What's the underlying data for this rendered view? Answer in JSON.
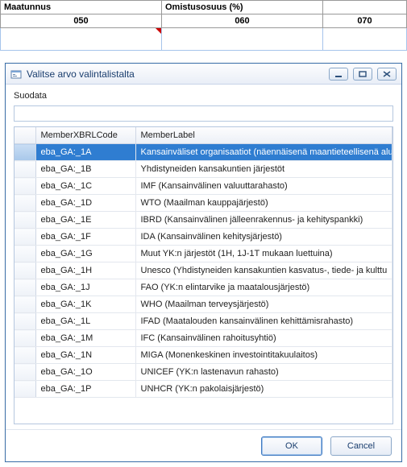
{
  "bgTable": {
    "headers": [
      "Maatunnus",
      "Omistusosuus (%)",
      ""
    ],
    "codes": [
      "050",
      "060",
      "070"
    ]
  },
  "dialog": {
    "title": "Valitse arvo valintalistalta",
    "filterLabel": "Suodata",
    "filterValue": "",
    "filterPlaceholder": "",
    "columns": {
      "code": "MemberXBRLCode",
      "label": "MemberLabel"
    },
    "rows": [
      {
        "code": "eba_GA:_1A",
        "label": "Kansainväliset organisaatiot (näennäisenä maantieteellisenä alu"
      },
      {
        "code": "eba_GA:_1B",
        "label": "Yhdistyneiden kansakuntien järjestöt"
      },
      {
        "code": "eba_GA:_1C",
        "label": "IMF (Kansainvälinen valuuttarahasto)"
      },
      {
        "code": "eba_GA:_1D",
        "label": "WTO (Maailman kauppajärjestö)"
      },
      {
        "code": "eba_GA:_1E",
        "label": "IBRD (Kansainvälinen jälleenrakennus- ja kehityspankki)"
      },
      {
        "code": "eba_GA:_1F",
        "label": "IDA (Kansainvälinen kehitysjärjestö)"
      },
      {
        "code": "eba_GA:_1G",
        "label": "Muut YK:n järjestöt (1H, 1J-1T mukaan luettuina)"
      },
      {
        "code": "eba_GA:_1H",
        "label": "Unesco (Yhdistyneiden kansakuntien kasvatus-, tiede- ja kulttu"
      },
      {
        "code": "eba_GA:_1J",
        "label": "FAO (YK:n elintarvike ja maatalousjärjestö)"
      },
      {
        "code": "eba_GA:_1K",
        "label": "WHO (Maailman terveysjärjestö)"
      },
      {
        "code": "eba_GA:_1L",
        "label": "IFAD (Maatalouden kansainvälinen kehittämisrahasto)"
      },
      {
        "code": "eba_GA:_1M",
        "label": "IFC (Kansainvälinen rahoitusyhtiö)"
      },
      {
        "code": "eba_GA:_1N",
        "label": "MIGA (Monenkeskinen investointitakuulaitos)"
      },
      {
        "code": "eba_GA:_1O",
        "label": "UNICEF (YK:n lastenavun rahasto)"
      },
      {
        "code": "eba_GA:_1P",
        "label": "UNHCR (YK:n pakolaisjärjestö)"
      }
    ],
    "selectedIndex": 0,
    "buttons": {
      "ok": "OK",
      "cancel": "Cancel"
    }
  }
}
